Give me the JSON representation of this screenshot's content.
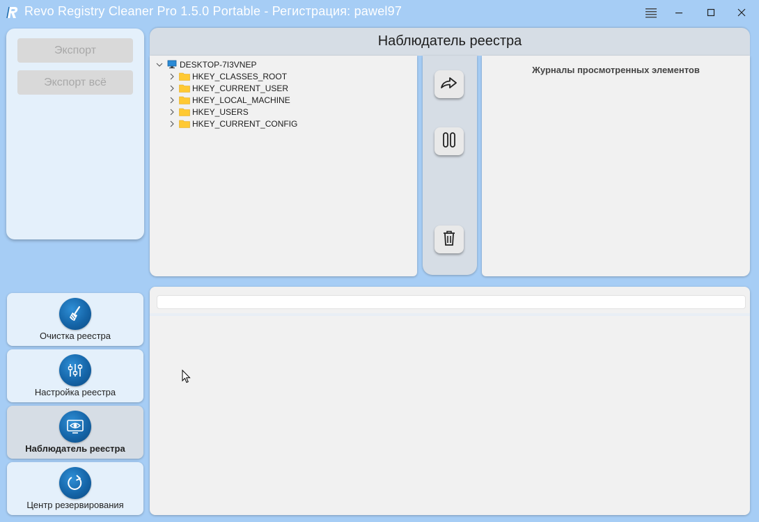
{
  "window": {
    "title": "Revo Registry Cleaner Pro 1.5.0 Portable - Регистрация: pawel97"
  },
  "export_panel": {
    "export_label": "Экспорт",
    "export_all_label": "Экспорт всё"
  },
  "monitor": {
    "title": "Наблюдатель реестра",
    "tree": {
      "root": "DESKTOP-7I3VNEP",
      "children": [
        "HKEY_CLASSES_ROOT",
        "HKEY_CURRENT_USER",
        "HKEY_LOCAL_MACHINE",
        "HKEY_USERS",
        "HKEY_CURRENT_CONFIG"
      ]
    },
    "log_title": "Журналы просмотренных элементов"
  },
  "bottom": {
    "input_value": ""
  },
  "nav": {
    "items": [
      {
        "label": "Очистка реестра",
        "icon": "broom-icon"
      },
      {
        "label": "Настройка реестра",
        "icon": "sliders-icon"
      },
      {
        "label": "Наблюдатель реестра",
        "icon": "monitor-eye-icon"
      },
      {
        "label": "Центр резервирования",
        "icon": "backup-refresh-icon"
      }
    ],
    "active_index": 2
  },
  "colors": {
    "background": "#a6cdf5",
    "panel": "#f1f1f1",
    "header": "#d6dde5",
    "nav_bg": "#e4f0fb",
    "accent": "#1565a8",
    "folder": "#ffc933"
  }
}
